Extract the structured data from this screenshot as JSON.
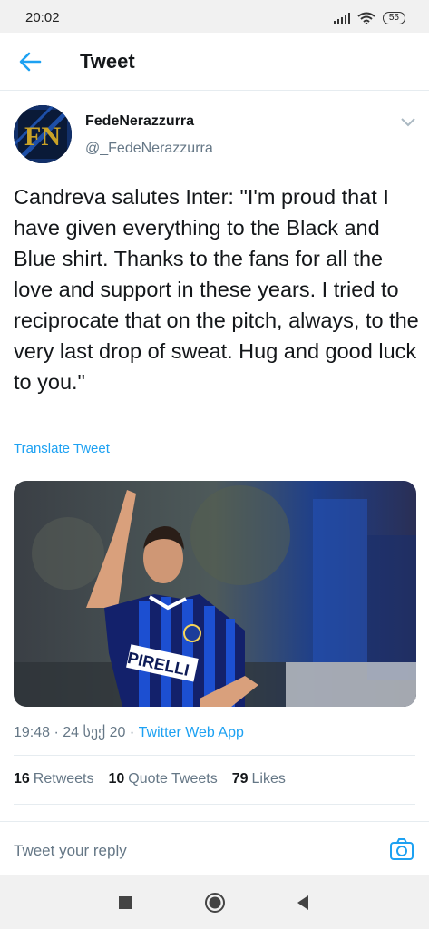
{
  "status_bar": {
    "time": "20:02",
    "battery": "55",
    "icons": [
      "signal-icon",
      "wifi-icon",
      "battery-icon"
    ]
  },
  "header": {
    "title": "Tweet",
    "back_icon": "back-arrow-icon"
  },
  "tweet": {
    "avatar_text": "FN",
    "display_name": "FedeNerazzurra",
    "handle": "@_FedeNerazzurra",
    "text": "Candreva salutes Inter: \"I'm proud that I have given everything to the Black and Blue shirt. Thanks to the fans for all the love and support in these years. I tried to reciprocate that on the pitch, always, to the very last drop of sweat. Hug and good luck to you.\"",
    "translate_label": "Translate Tweet",
    "media_logo_text": "PIRELLI",
    "meta_date": "19:48 · 24 სექ 20 · ",
    "meta_source": "Twitter Web App"
  },
  "stats": {
    "retweets_count": "16",
    "retweets_label": "Retweets",
    "quote_count": "10",
    "quote_label": "Quote Tweets",
    "likes_count": "79",
    "likes_label": "Likes"
  },
  "reply": {
    "placeholder": "Tweet your reply",
    "camera_icon": "camera-icon"
  },
  "nav": {
    "icons": [
      "recent-apps-icon",
      "home-icon",
      "back-icon"
    ]
  },
  "colors": {
    "accent": "#1da1f2",
    "text": "#14171a",
    "secondary": "#657786",
    "inter_blue": "#0d47c5"
  }
}
